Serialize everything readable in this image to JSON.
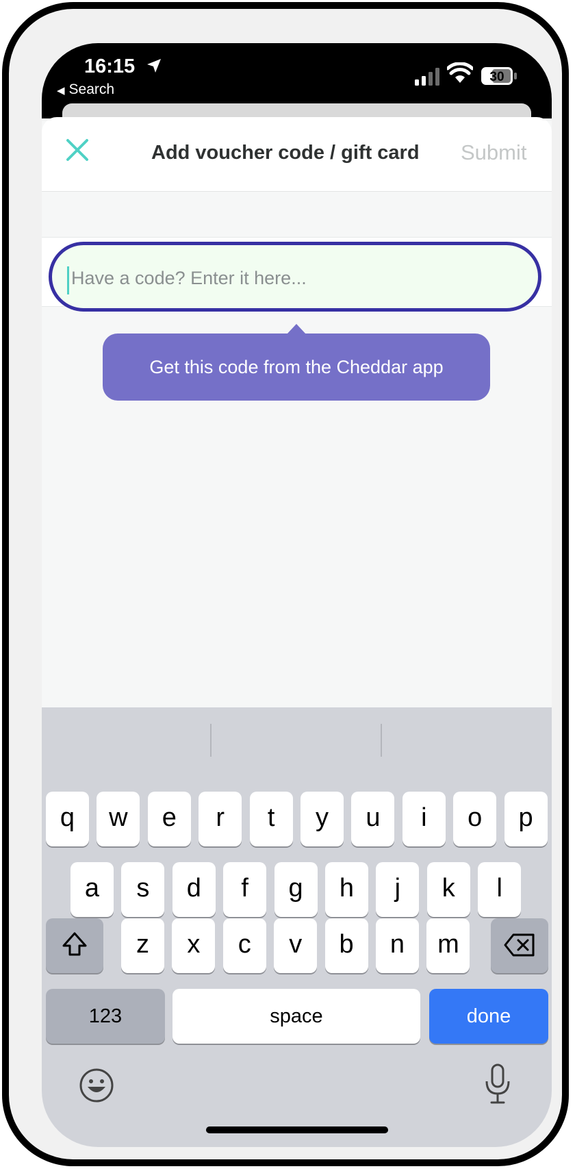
{
  "status_bar": {
    "time": "16:15",
    "back_label": "Search",
    "battery": "30",
    "icons": [
      "location-arrow-icon",
      "cellular-signal-icon",
      "wifi-icon",
      "battery-icon"
    ]
  },
  "header": {
    "title": "Add voucher code / gift card",
    "submit_label": "Submit",
    "close_icon": "close-icon",
    "accent_color": "#4fd1c5"
  },
  "code_input": {
    "placeholder": "Have a code? Enter it here...",
    "value": "",
    "border_color": "#3730a3"
  },
  "tooltip": {
    "text": "Get this code from the Cheddar app",
    "color": "#7570c8"
  },
  "keyboard": {
    "row1": [
      "q",
      "w",
      "e",
      "r",
      "t",
      "y",
      "u",
      "i",
      "o",
      "p"
    ],
    "row2": [
      "a",
      "s",
      "d",
      "f",
      "g",
      "h",
      "j",
      "k",
      "l"
    ],
    "row3": [
      "z",
      "x",
      "c",
      "v",
      "b",
      "n",
      "m"
    ],
    "numbers_label": "123",
    "space_label": "space",
    "done_label": "done",
    "done_color": "#3478f6",
    "icons": [
      "shift-icon",
      "backspace-icon",
      "emoji-icon",
      "microphone-icon"
    ]
  }
}
